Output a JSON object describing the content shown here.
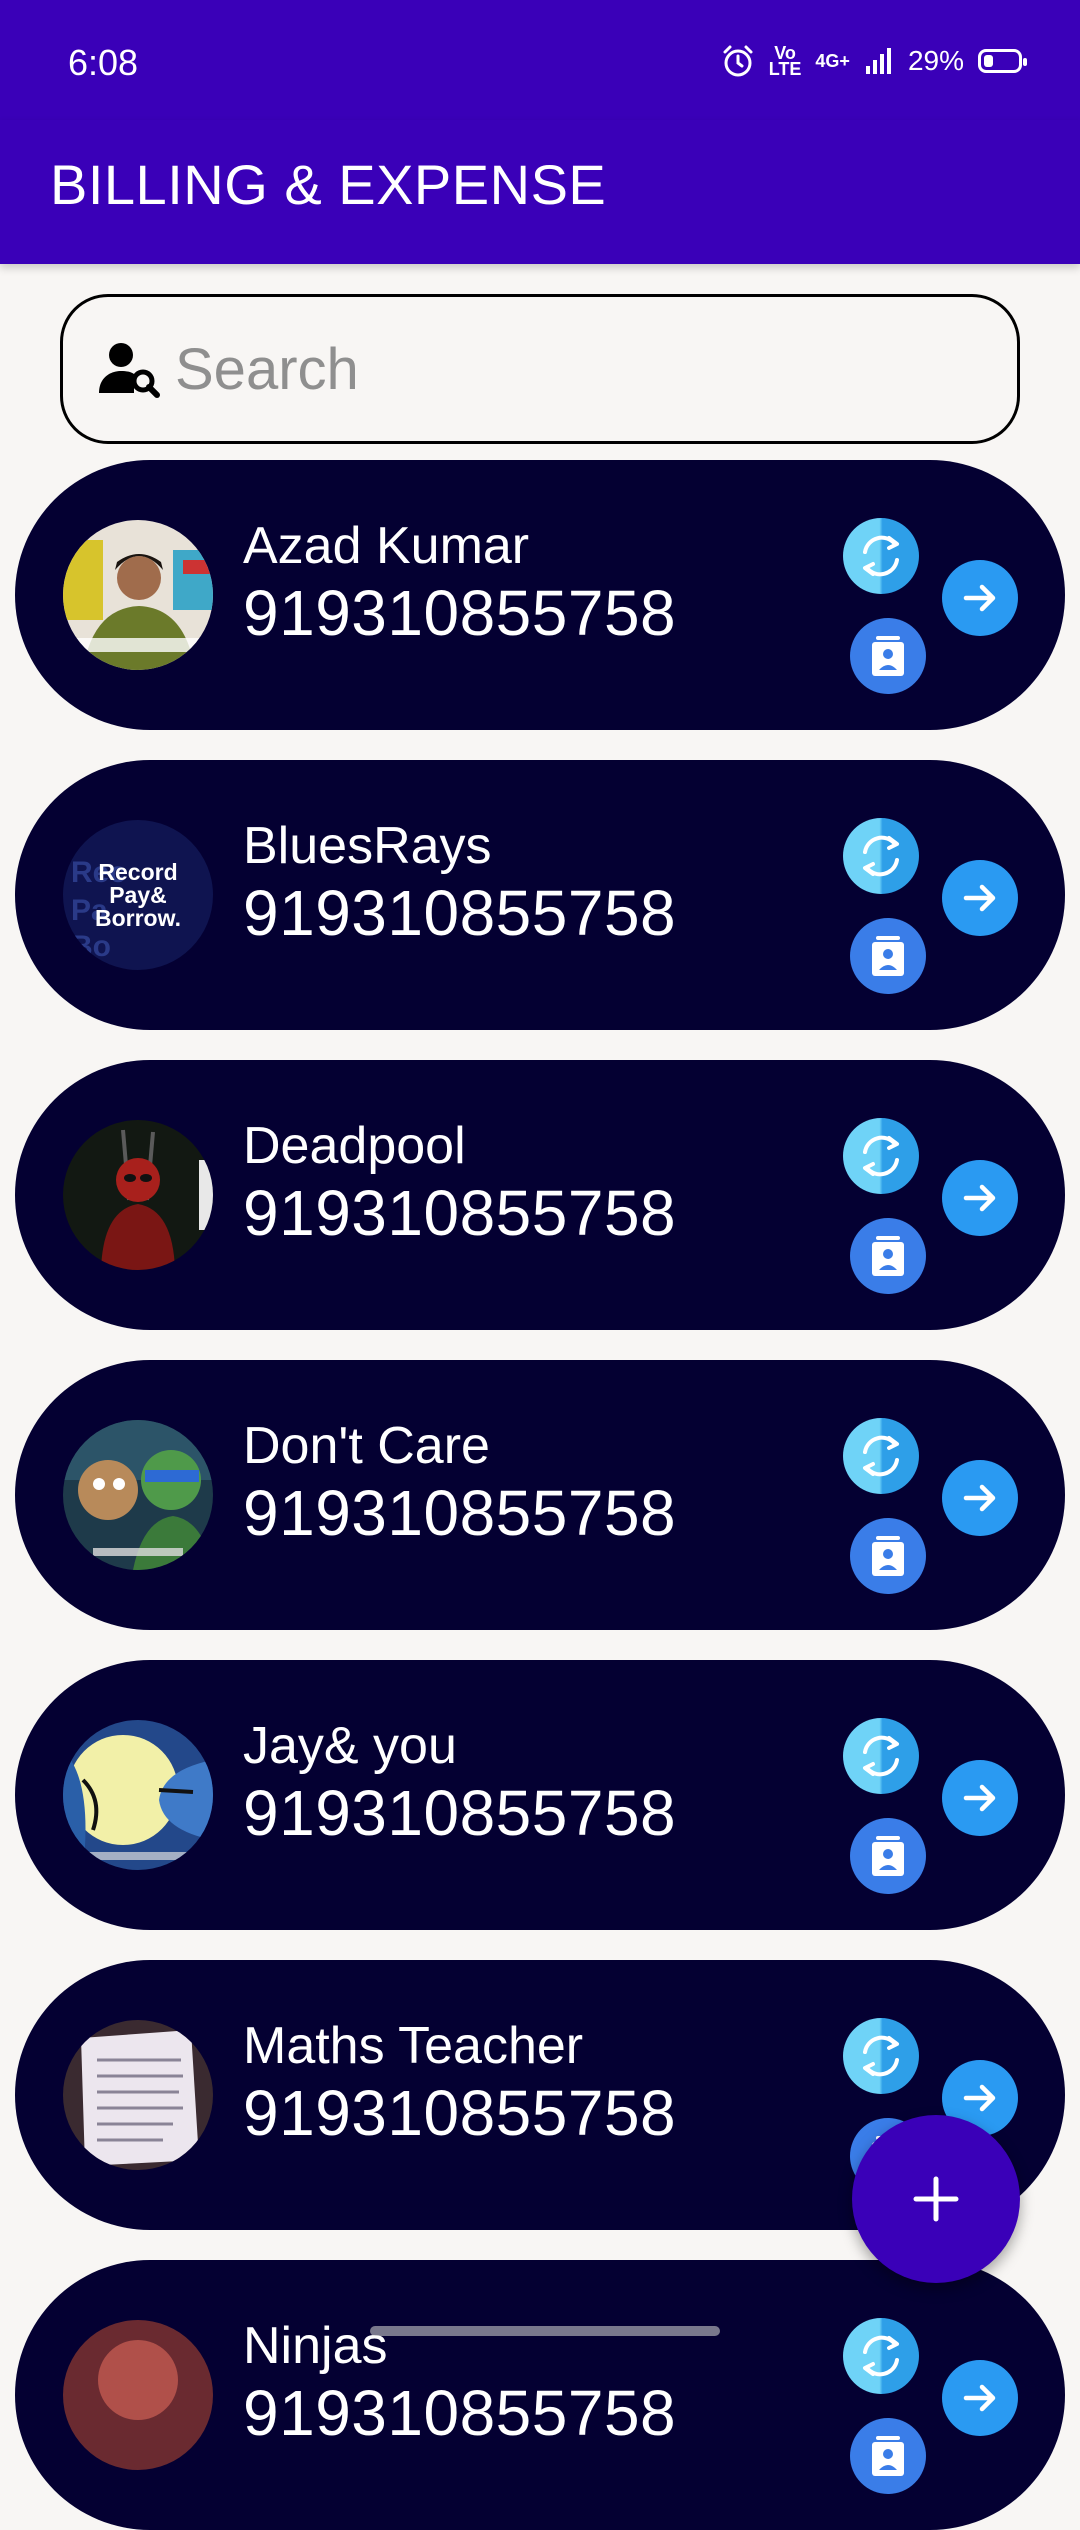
{
  "status_bar": {
    "time": "6:08",
    "volte": "Vo\nLTE",
    "network": "4G+",
    "battery": "29%",
    "battery_level": 0.29
  },
  "app_bar": {
    "title": "BILLING & EXPENSE"
  },
  "search": {
    "placeholder": "Search",
    "value": ""
  },
  "contacts": [
    {
      "name": "Azad Kumar",
      "phone": "919310855758"
    },
    {
      "name": "BluesRays",
      "phone": "919310855758",
      "avatar_text": [
        "Record",
        "Pay&",
        "Borrow."
      ]
    },
    {
      "name": "Deadpool",
      "phone": "919310855758"
    },
    {
      "name": "Don't Care",
      "phone": "919310855758"
    },
    {
      "name": "Jay& you",
      "phone": "919310855758"
    },
    {
      "name": "Maths Teacher",
      "phone": "919310855758"
    },
    {
      "name": "Ninjas",
      "phone": "919310855758"
    }
  ],
  "icons": {
    "sync": "sync-icon",
    "delete": "delete-icon",
    "open": "arrow-right-icon",
    "add": "plus-icon",
    "search": "person-search-icon"
  },
  "colors": {
    "primary": "#3a00b8",
    "card": "#040032",
    "accent": "#2a9af2",
    "background": "#f8f6f4"
  }
}
